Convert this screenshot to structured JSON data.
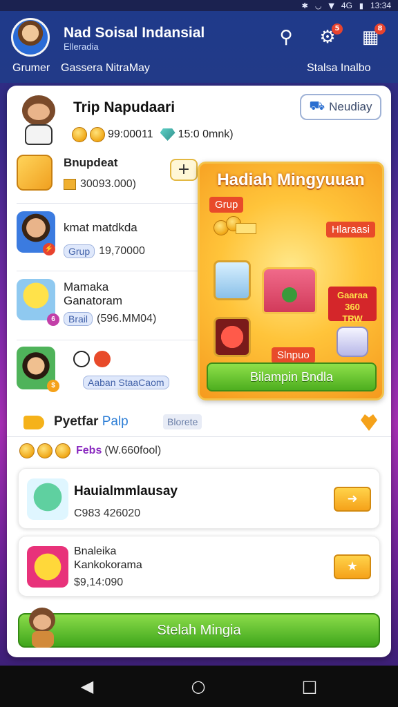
{
  "status_bar": {
    "signal": "4G",
    "time": "13:34"
  },
  "header": {
    "title": "Nad Soisal Indansial",
    "subtitle": "Elleradia",
    "left_link": "Grumer",
    "center_link": "Gassera NitraMay",
    "right_link": "Stalsa Inalbo",
    "icons": [
      "map-pin-icon",
      "settings-icon",
      "gift-icon"
    ],
    "badges": {
      "settings": "5",
      "gift": "8"
    }
  },
  "trip": {
    "title": "Trip Napudaari",
    "nearby_label": "Neudiay",
    "coins": "99:00011",
    "gems": "15:0 0mnk)"
  },
  "list": [
    {
      "title": "Bnupdeat",
      "value": "30093.000)"
    },
    {
      "title": "kmat matdkda",
      "chip": "Grup",
      "value": "19,70000"
    },
    {
      "title": "Mamaka\nGanatoram",
      "chip": "Brail",
      "value": "(596.MM04)"
    },
    {
      "title": "",
      "chip": "Aaban StaaCaom",
      "value": ""
    }
  ],
  "reward": {
    "title": "Hadiah Mingyuuan",
    "tag_left": "Grup",
    "tag_right": "Hlaraasi",
    "price": "Gaaraa\n360\nTRW",
    "tag_bottom": "Slnpuo",
    "cta": "Bilampin Bndla"
  },
  "section": {
    "title": "Pyetfar",
    "title_accent": "Palp",
    "chip": "Blorete"
  },
  "fees": {
    "label": "Febs",
    "value": "(W.660fool)"
  },
  "items": [
    {
      "title": "Hauialmmlausay",
      "value": "C983 426020"
    },
    {
      "title": "Bnaleika\nKankokorama",
      "value": "$9,14:090"
    }
  ],
  "bottom_cta": "Stelah Mingia",
  "colors": {
    "accent": "#2f7fd6",
    "cta_green": "#4dae1f",
    "gold": "#f5a21a",
    "header_blue": "#1f3a8a"
  }
}
